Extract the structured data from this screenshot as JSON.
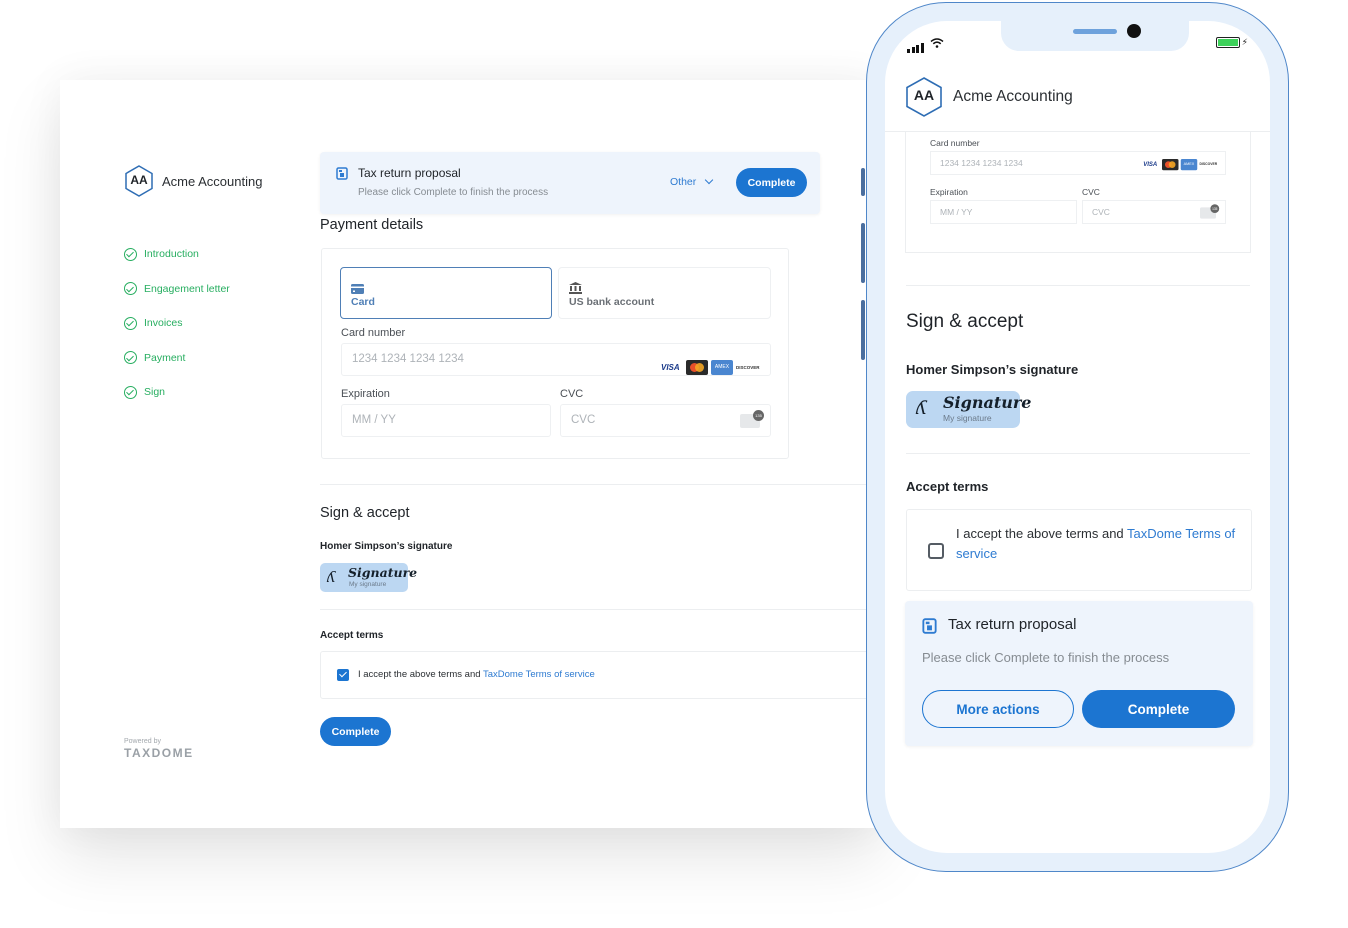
{
  "brand": {
    "initials": "AA",
    "name": "Acme Accounting"
  },
  "colors": {
    "accent": "#1c75d1",
    "success": "#27ae60",
    "banner_bg": "#eef4fc",
    "signature_bg": "#bcd7f2"
  },
  "desktop": {
    "steps": [
      {
        "label": "Introduction",
        "status": "complete"
      },
      {
        "label": "Engagement letter",
        "status": "complete"
      },
      {
        "label": "Invoices",
        "status": "complete"
      },
      {
        "label": "Payment",
        "status": "complete"
      },
      {
        "label": "Sign",
        "status": "complete"
      }
    ],
    "powered_by": {
      "label": "Powered by",
      "brand": "TAXDOME"
    },
    "banner": {
      "icon": "document-icon",
      "title": "Tax return proposal",
      "subtitle": "Please click Complete to finish the process",
      "other_label": "Other",
      "complete_label": "Complete"
    },
    "payment": {
      "heading": "Payment details",
      "methods": [
        {
          "label": "Card",
          "icon": "credit-card-icon",
          "selected": true
        },
        {
          "label": "US bank account",
          "icon": "bank-icon",
          "selected": false
        }
      ],
      "card_number_label": "Card number",
      "card_number_placeholder": "1234 1234 1234 1234",
      "card_brands": [
        "VISA",
        "Mastercard",
        "AMEX",
        "DISCOVER"
      ],
      "expiration_label": "Expiration",
      "expiration_placeholder": "MM / YY",
      "cvc_label": "CVC",
      "cvc_placeholder": "CVC"
    },
    "sign": {
      "heading": "Sign & accept",
      "signature_label": "Homer Simpson’s signature",
      "signature_text": "Signature",
      "signature_caption": "My signature",
      "accept_heading": "Accept terms",
      "accept_text": "I accept the above terms and ",
      "accept_link": "TaxDome Terms of service",
      "accept_checked": true,
      "complete_label": "Complete"
    }
  },
  "phone": {
    "payment": {
      "card_number_label": "Card number",
      "card_number_placeholder": "1234 1234 1234 1234",
      "expiration_label": "Expiration",
      "expiration_placeholder": "MM / YY",
      "cvc_label": "CVC",
      "cvc_placeholder": "CVC"
    },
    "sign": {
      "heading": "Sign & accept",
      "signature_label": "Homer Simpson’s signature",
      "signature_text": "Signature",
      "signature_caption": "My signature",
      "accept_heading": "Accept terms",
      "accept_text": "I accept the above terms and ",
      "accept_link": "TaxDome Terms of service",
      "accept_checked": false
    },
    "banner": {
      "title": "Tax return proposal",
      "subtitle": "Please click Complete to finish the process",
      "more_label": "More actions",
      "complete_label": "Complete"
    },
    "status_bar": {
      "battery_level": 1.0,
      "charging": true
    }
  }
}
